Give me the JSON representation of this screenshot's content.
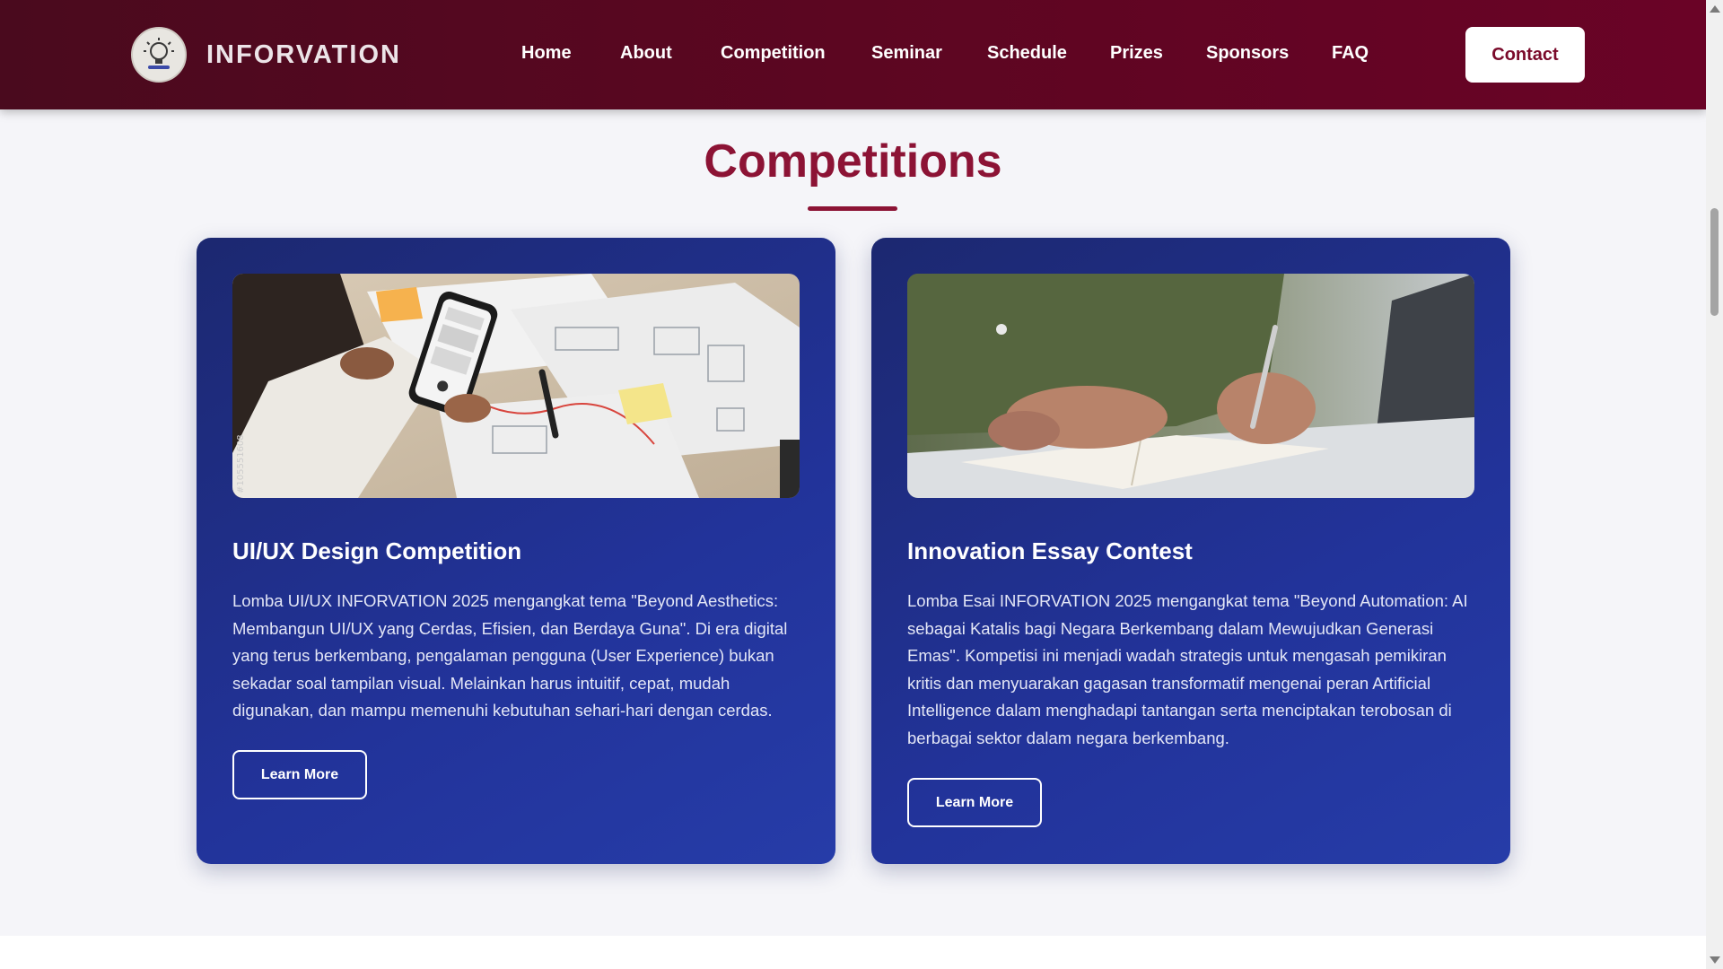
{
  "navbar": {
    "brand": "INFORVATION",
    "links": [
      "Home",
      "About",
      "Competition",
      "Seminar",
      "Schedule",
      "Prizes",
      "Sponsors",
      "FAQ"
    ],
    "contact_label": "Contact"
  },
  "section": {
    "title": "Competitions"
  },
  "cards": [
    {
      "title": "UI/UX Design Competition",
      "description": "Lomba UI/UX INFORVATION 2025 mengangkat tema \"Beyond Aesthetics: Membangun UI/UX yang Cerdas, Efisien, dan Berdaya Guna\". Di era digital yang terus berkembang, pengalaman pengguna (User Experience) bukan sekadar soal tampilan visual. Melainkan harus intuitif, cepat, mudah digunakan, dan mampu memenuhi kebutuhan sehari-hari dengan cerdas.",
      "button_label": "Learn More",
      "image_watermark": "#105551608"
    },
    {
      "title": "Innovation Essay Contest",
      "description": "Lomba Esai INFORVATION 2025 mengangkat tema \"Beyond Automation: AI sebagai Katalis bagi Negara Berkembang dalam Mewujudkan Generasi Emas\". Kompetisi ini menjadi wadah strategis untuk mengasah pemikiran kritis dan menyuarakan gagasan transformatif mengenai peran Artificial Intelligence dalam menghadapi tantangan serta menciptakan terobosan di berbagai sektor dalam negara berkembang.",
      "button_label": "Learn More"
    }
  ],
  "colors": {
    "nav_bg": "#5c0621",
    "accent": "#8c1335",
    "card_bg": "#22339a"
  }
}
